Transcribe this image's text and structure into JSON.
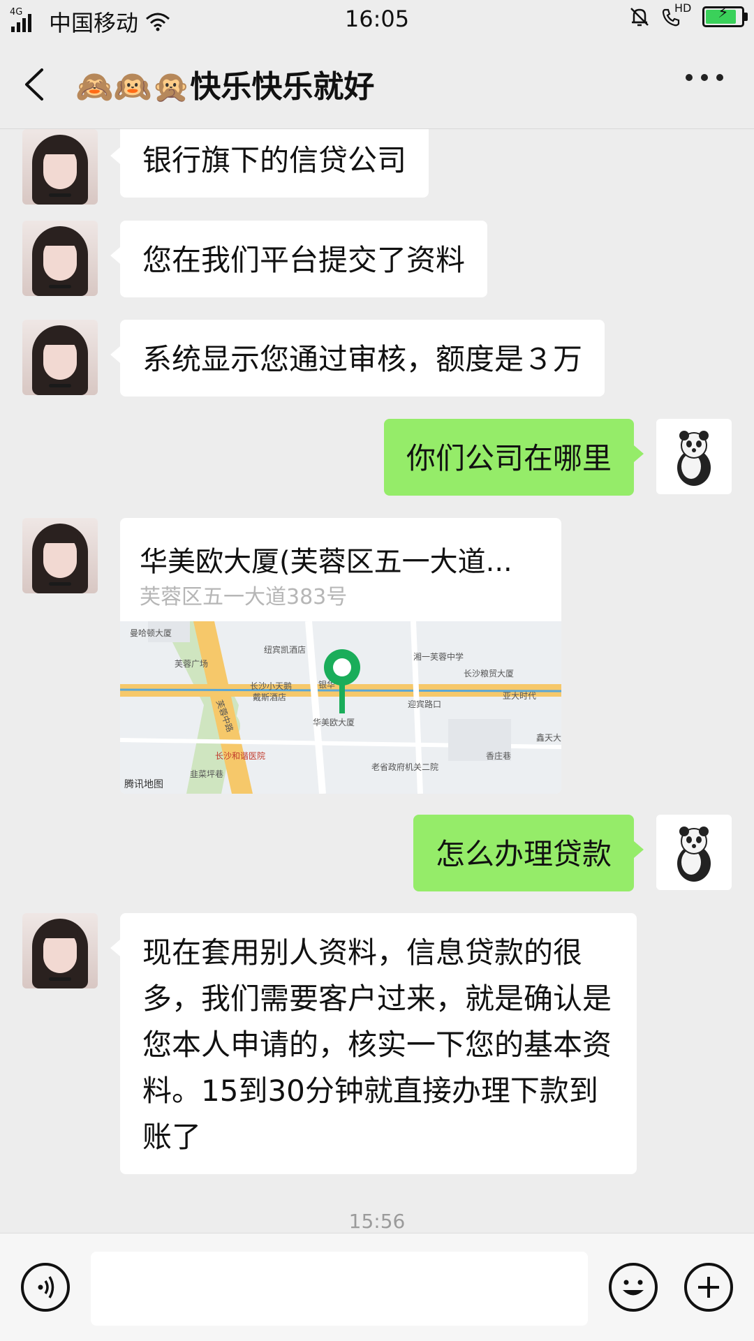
{
  "status_bar": {
    "network": "4G",
    "carrier": "中国移动",
    "time": "16:05",
    "hd_label": "HD"
  },
  "header": {
    "title": "🙈🙉🙊快乐快乐就好"
  },
  "messages": {
    "m1": "银行旗下的信贷公司",
    "m2": "您在我们平台提交了资料",
    "m3": "系统显示您通过审核，额度是３万",
    "m4": "你们公司在哪里",
    "location": {
      "name": "华美欧大厦(芙蓉区五一大道...",
      "address": "芙蓉区五一大道383号",
      "brand": "腾讯地图",
      "pin_label": "华美欧大厦",
      "map_labels": [
        "曼哈顿大厦",
        "芙蓉广场",
        "纽宾凯酒店",
        "湘一芙蓉中学",
        "长沙粮贸大厦",
        "长沙小天鹅",
        "戴斯酒店",
        "迎宾路口",
        "亚大时代",
        "芙蓉中路",
        "长沙和谐医院",
        "老省政府机关二院",
        "鑫天大",
        "香庄巷",
        "韭菜坪巷",
        "银华"
      ]
    },
    "m5": "怎么办理贷款",
    "m6": "现在套用别人资料，信息贷款的很多，我们需要客户过来，就是确认是您本人申请的，核实一下您的基本资料。15到30分钟就直接办理下款到账了"
  },
  "timestamp": "15:56",
  "colors": {
    "outgoing_bubble": "#95ec69",
    "incoming_bubble": "#ffffff",
    "background": "#ededed"
  },
  "icons": {
    "voice": "voice-icon",
    "emoji": "emoji-icon",
    "add": "plus-icon",
    "back": "back-arrow-icon",
    "more": "more-dots-icon"
  }
}
